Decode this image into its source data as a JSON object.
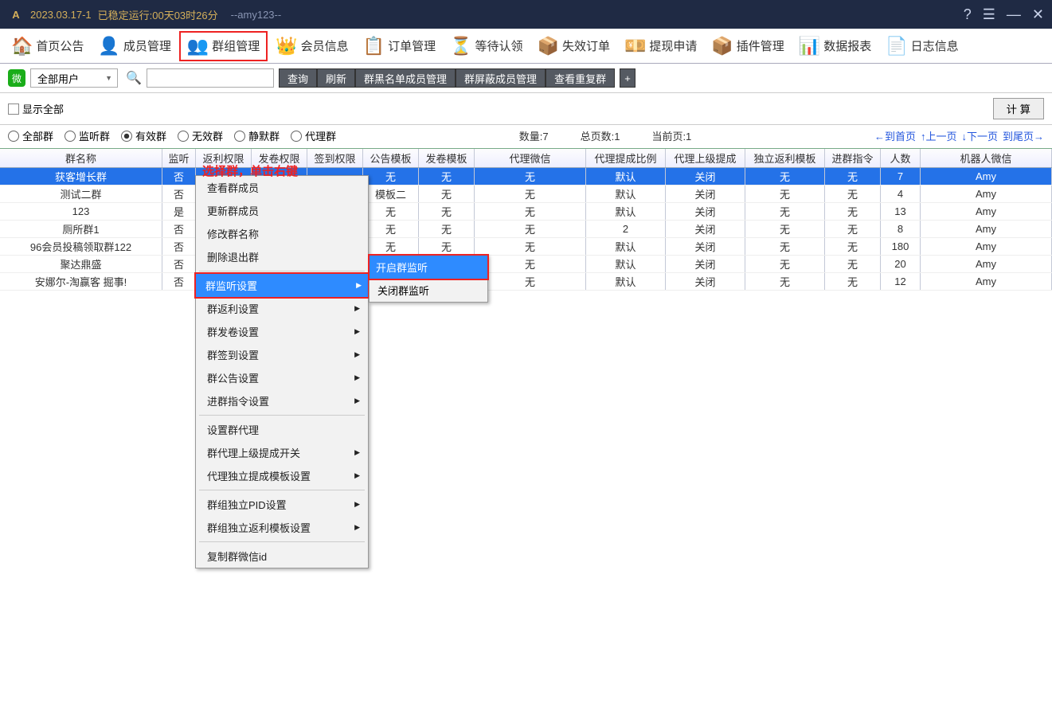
{
  "titlebar": {
    "version": "2023.03.17-1",
    "uptime": "已稳定运行:00天03时26分",
    "user": "--amy123--"
  },
  "toolbar": [
    {
      "label": "首页公告",
      "name": "home-announce"
    },
    {
      "label": "成员管理",
      "name": "members"
    },
    {
      "label": "群组管理",
      "name": "groups",
      "active": true
    },
    {
      "label": "会员信息",
      "name": "vip-info"
    },
    {
      "label": "订单管理",
      "name": "orders"
    },
    {
      "label": "等待认领",
      "name": "pending"
    },
    {
      "label": "失效订单",
      "name": "invalid-orders"
    },
    {
      "label": "提现申请",
      "name": "withdraw"
    },
    {
      "label": "插件管理",
      "name": "plugins"
    },
    {
      "label": "数据报表",
      "name": "reports"
    },
    {
      "label": "日志信息",
      "name": "logs"
    }
  ],
  "filter": {
    "user_sel": "全部用户",
    "btns": [
      "查询",
      "刷新",
      "群黑名单成员管理",
      "群屏蔽成员管理",
      "查看重复群"
    ]
  },
  "options": {
    "show_all": "显示全部",
    "radios": [
      "全部群",
      "监听群",
      "有效群",
      "无效群",
      "静默群",
      "代理群"
    ],
    "selected": 2,
    "calc": "计 算"
  },
  "stats": {
    "count": "数量:7",
    "pages": "总页数:1",
    "current": "当前页:1"
  },
  "pager": [
    "←到首页",
    "↑上一页",
    "↓下一页",
    "到尾页→"
  ],
  "cols": [
    "群名称",
    "监听",
    "返利权限",
    "发卷权限",
    "签到权限",
    "公告模板",
    "发卷模板",
    "代理微信",
    "代理提成比例",
    "代理上级提成",
    "独立返利模板",
    "进群指令",
    "人数",
    "机器人微信"
  ],
  "rows": [
    {
      "sel": true,
      "c": [
        "获客增长群",
        "否",
        "",
        "",
        "",
        "无",
        "无",
        "无",
        "默认",
        "关闭",
        "无",
        "无",
        "7",
        "Amy"
      ]
    },
    {
      "c": [
        "测试二群",
        "否",
        "",
        "",
        "",
        "模板二",
        "无",
        "无",
        "默认",
        "关闭",
        "无",
        "无",
        "4",
        "Amy"
      ]
    },
    {
      "c": [
        "123",
        "是",
        "",
        "",
        "",
        "无",
        "无",
        "无",
        "默认",
        "关闭",
        "无",
        "无",
        "13",
        "Amy"
      ]
    },
    {
      "c": [
        "厕所群1",
        "否",
        "",
        "",
        "",
        "无",
        "无",
        "无",
        "2",
        "关闭",
        "无",
        "无",
        "8",
        "Amy"
      ]
    },
    {
      "c": [
        "96会员投稿领取群122",
        "否",
        "",
        "",
        "",
        "无",
        "无",
        "无",
        "默认",
        "关闭",
        "无",
        "无",
        "180",
        "Amy"
      ]
    },
    {
      "c": [
        "聚达鼎盛",
        "否",
        "",
        "",
        "",
        "无",
        "无",
        "无",
        "默认",
        "关闭",
        "无",
        "无",
        "20",
        "Amy"
      ]
    },
    {
      "c": [
        "安娜尔-淘赢客 掘事!",
        "否",
        "",
        "",
        "",
        "无",
        "无",
        "无",
        "默认",
        "关闭",
        "无",
        "无",
        "12",
        "Amy"
      ]
    }
  ],
  "ctxmenu": [
    {
      "t": "查看群成员"
    },
    {
      "t": "更新群成员"
    },
    {
      "t": "修改群名称"
    },
    {
      "t": "删除退出群"
    },
    {
      "sep": true
    },
    {
      "t": "群监听设置",
      "arrow": true,
      "hover": true,
      "boxed": true
    },
    {
      "t": "群返利设置",
      "arrow": true
    },
    {
      "t": "群发卷设置",
      "arrow": true
    },
    {
      "t": "群签到设置",
      "arrow": true
    },
    {
      "t": "群公告设置",
      "arrow": true
    },
    {
      "t": "进群指令设置",
      "arrow": true
    },
    {
      "sep": true
    },
    {
      "t": "设置群代理"
    },
    {
      "t": "群代理上级提成开关",
      "arrow": true
    },
    {
      "t": "代理独立提成模板设置",
      "arrow": true
    },
    {
      "sep": true
    },
    {
      "t": "群组独立PID设置",
      "arrow": true
    },
    {
      "t": "群组独立返利模板设置",
      "arrow": true
    },
    {
      "sep": true
    },
    {
      "t": "复制群微信id"
    }
  ],
  "submenu": [
    {
      "t": "开启群监听",
      "hover": true,
      "boxed": true
    },
    {
      "t": "关闭群监听"
    }
  ],
  "annotation": "选择群，单击右键"
}
